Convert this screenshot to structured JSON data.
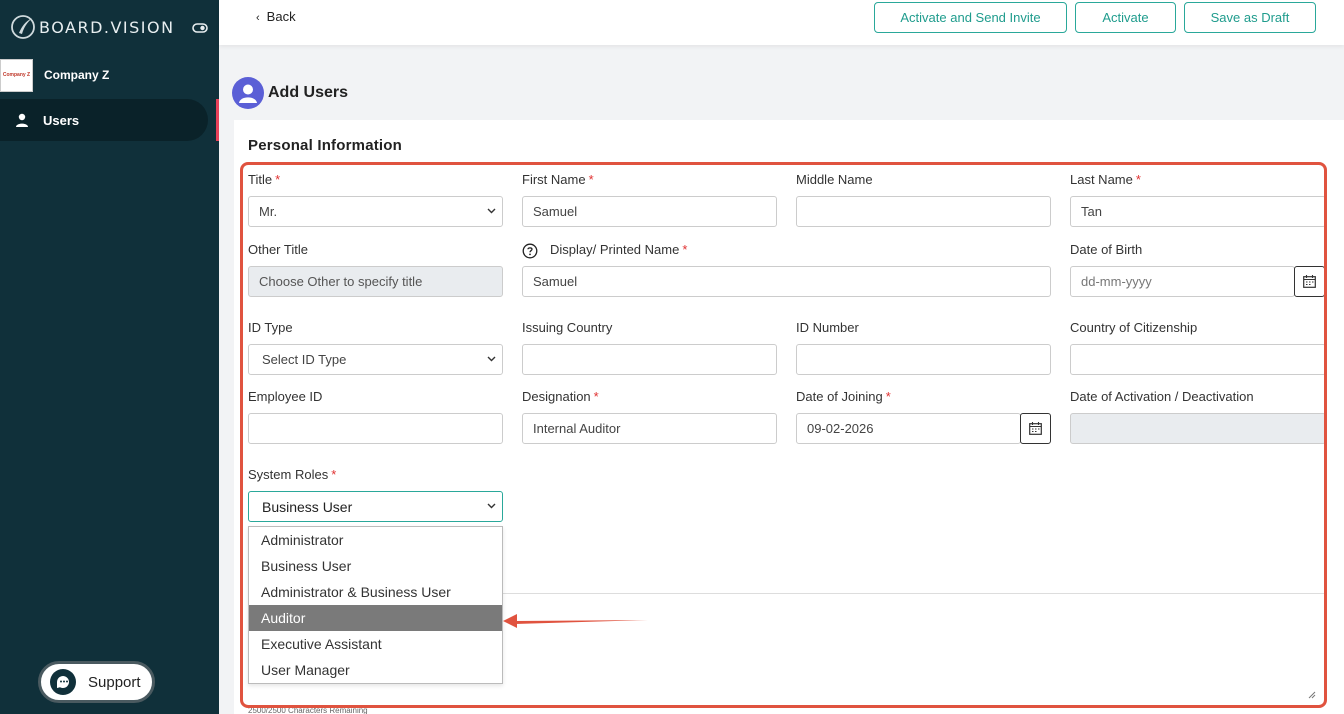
{
  "brand": {
    "name": "BOARD.VISION"
  },
  "sidebar": {
    "company_logo_text": "Company Z",
    "company_name": "Company Z",
    "nav_users": "Users",
    "support_label": "Support"
  },
  "topbar": {
    "back_label": "Back",
    "activate_send_invite": "Activate and Send Invite",
    "activate": "Activate",
    "save_draft": "Save as Draft"
  },
  "page": {
    "title": "Add Users",
    "section_title": "Personal Information"
  },
  "form": {
    "title_label": "Title",
    "title_value": "Mr.",
    "first_name_label": "First Name",
    "first_name_value": "Samuel",
    "middle_name_label": "Middle Name",
    "middle_name_value": "",
    "last_name_label": "Last Name",
    "last_name_value": "Tan",
    "other_title_label": "Other Title",
    "other_title_placeholder": "Choose Other to specify title",
    "display_name_label": "Display/ Printed Name",
    "display_name_value": "Samuel",
    "dob_label": "Date of Birth",
    "dob_placeholder": "dd-mm-yyyy",
    "id_type_label": "ID Type",
    "id_type_value": "Select ID Type",
    "issuing_country_label": "Issuing Country",
    "issuing_country_value": "",
    "id_number_label": "ID Number",
    "id_number_value": "",
    "citizenship_label": "Country of Citizenship",
    "citizenship_value": "",
    "employee_id_label": "Employee ID",
    "employee_id_value": "",
    "designation_label": "Designation",
    "designation_value": "Internal Auditor",
    "joining_label": "Date of Joining",
    "joining_value": "09-02-2026",
    "activation_label": "Date of Activation / Deactivation",
    "activation_value": "",
    "system_roles_label": "System Roles",
    "system_roles_value": "Business User",
    "required_mark": "*",
    "char_remaining": "2500/2500 Characters Remaining"
  },
  "roles_options": [
    "Administrator",
    "Business User",
    "Administrator & Business User",
    "Auditor",
    "Executive Assistant",
    "User Manager"
  ],
  "colors": {
    "sidebar": "#10303a",
    "accent": "#2aa89a",
    "highlight": "#e0533f",
    "selected_option": "#7a7a7a"
  }
}
